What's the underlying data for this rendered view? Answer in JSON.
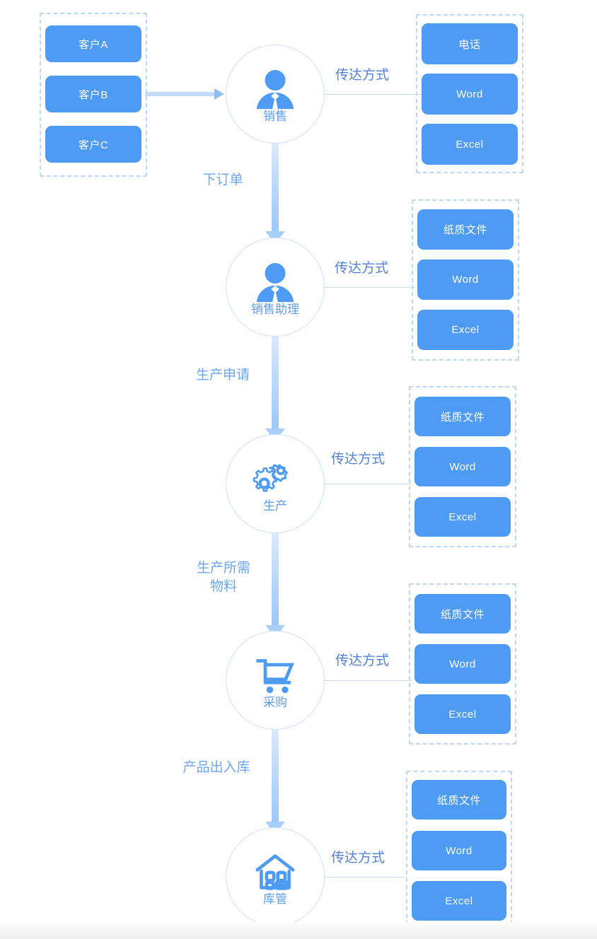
{
  "diagram": {
    "customers_group": {
      "name": "customers",
      "items": [
        "客户A",
        "客户B",
        "客户C"
      ]
    },
    "nodes": [
      {
        "id": "sales",
        "label": "销售",
        "icon": "person-icon"
      },
      {
        "id": "sales-asst",
        "label": "销售助理",
        "icon": "person-icon"
      },
      {
        "id": "production",
        "label": "生产",
        "icon": "gears-icon"
      },
      {
        "id": "purchasing",
        "label": "采购",
        "icon": "shopping-cart-icon"
      },
      {
        "id": "warehouse",
        "label": "库管",
        "icon": "warehouse-icon"
      }
    ],
    "flow_labels": [
      {
        "id": "order",
        "text": "下订单"
      },
      {
        "id": "prod-req",
        "text": "生产申请"
      },
      {
        "id": "materials",
        "text": "生产所需\n物料"
      },
      {
        "id": "stock",
        "text": "产品出入库"
      }
    ],
    "mode_label": "传达方式",
    "mode_groups": [
      {
        "owner": "sales",
        "items": [
          "电话",
          "Word",
          "Excel"
        ]
      },
      {
        "owner": "sales-asst",
        "items": [
          "纸质文件",
          "Word",
          "Excel"
        ]
      },
      {
        "owner": "production",
        "items": [
          "纸质文件",
          "Word",
          "Excel"
        ]
      },
      {
        "owner": "purchasing",
        "items": [
          "纸质文件",
          "Word",
          "Excel"
        ]
      },
      {
        "owner": "warehouse",
        "items": [
          "纸质文件",
          "Word",
          "Excel"
        ]
      }
    ],
    "colors": {
      "chip_blue": "#4e9bf4",
      "dashed_border": "#bcd6f7",
      "node_border": "#cfe0f7",
      "node_label": "#5b9cf3",
      "flow_label": "#6ca6f2",
      "mode_label": "#5281d8",
      "arrow": "#a7cff9",
      "background": "#ffffff"
    }
  }
}
